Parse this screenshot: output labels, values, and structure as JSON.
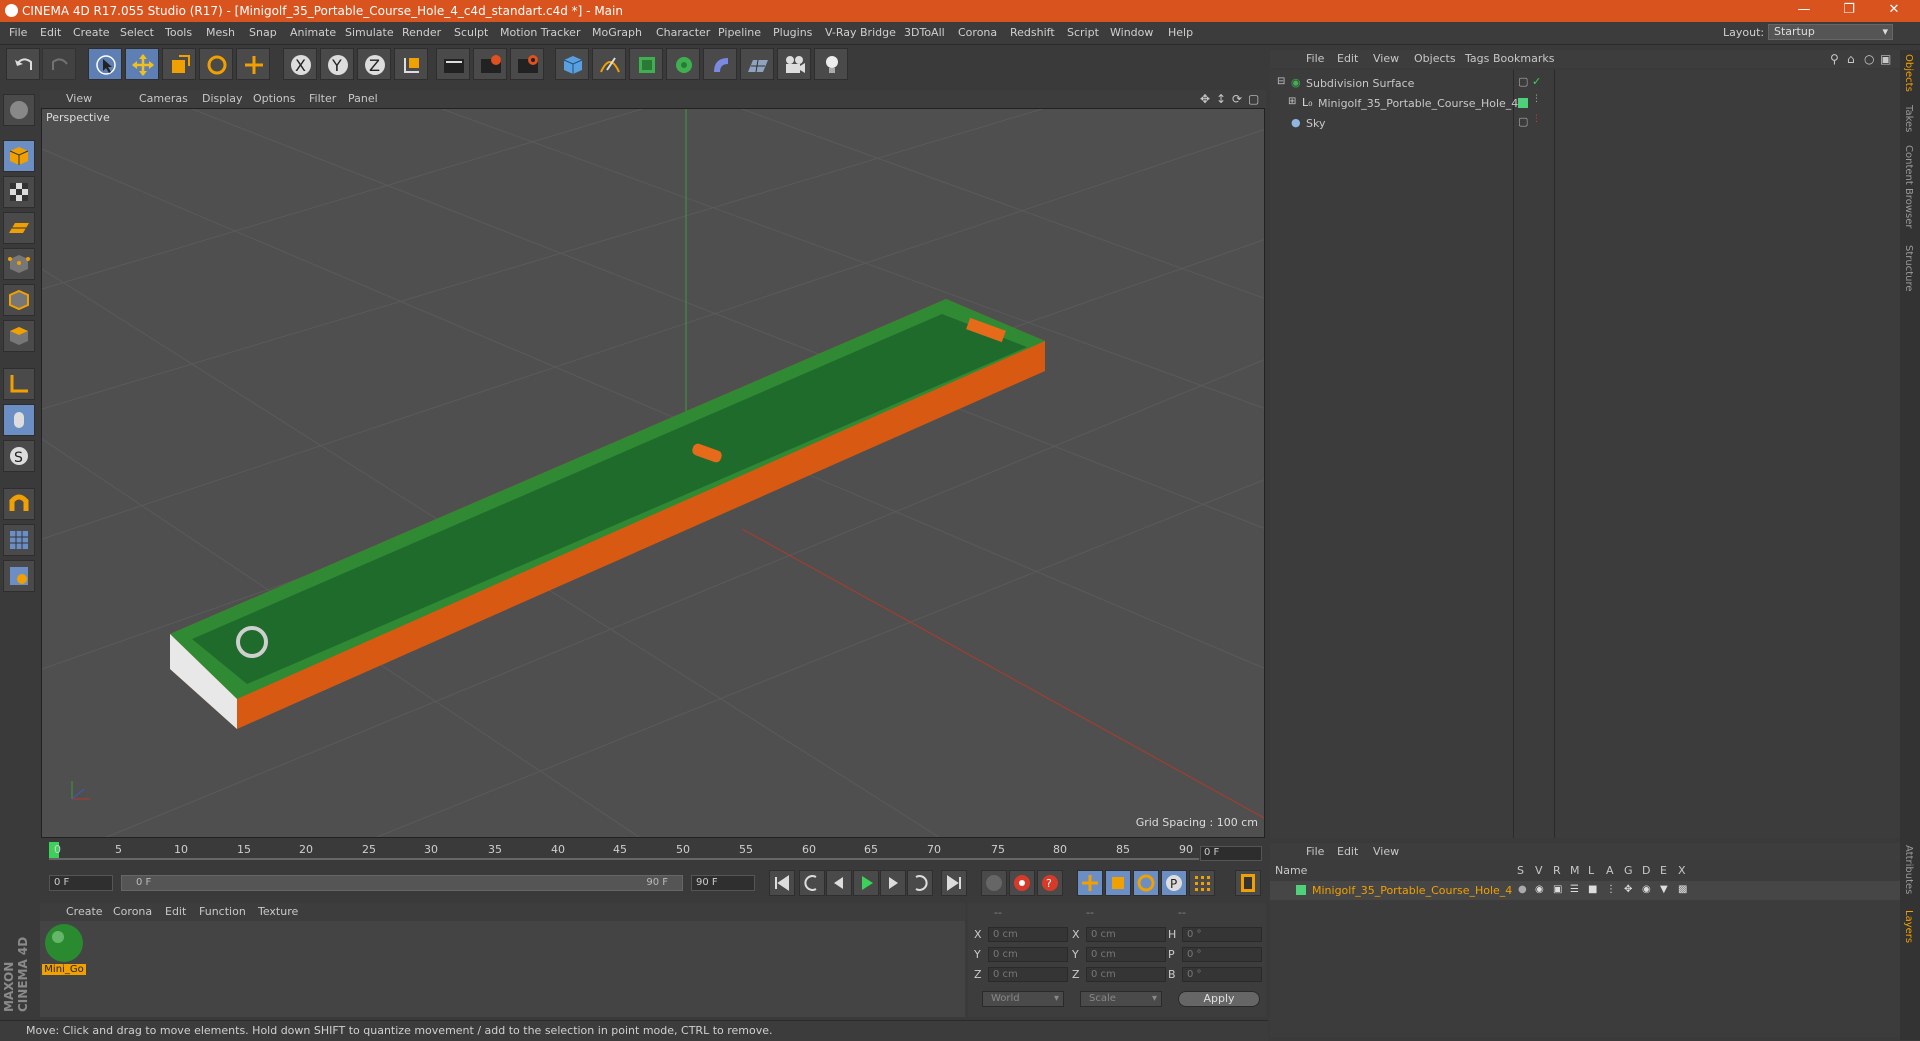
{
  "window": {
    "title": "CINEMA 4D R17.055 Studio (R17) - [Minigolf_35_Portable_Course_Hole_4_c4d_standart.c4d *] - Main",
    "min_icon": "minimize-icon",
    "max_icon": "restore-icon",
    "close_icon": "close-icon"
  },
  "menubar": {
    "items": [
      "File",
      "Edit",
      "Create",
      "Select",
      "Tools",
      "Mesh",
      "Snap",
      "Animate",
      "Simulate",
      "Render",
      "Sculpt",
      "Motion Tracker",
      "MoGraph",
      "Character",
      "Pipeline",
      "Plugins",
      "V-Ray Bridge",
      "3DToAll",
      "Corona",
      "Redshift",
      "Script",
      "Window",
      "Help"
    ],
    "layout_label": "Layout:",
    "layout_value": "Startup"
  },
  "viewport": {
    "menu": [
      "View",
      "Cameras",
      "Display",
      "Options",
      "Filter",
      "Panel"
    ],
    "label": "Perspective",
    "grid_spacing": "Grid Spacing : 100 cm"
  },
  "timeline": {
    "ticks": [
      "0",
      "5",
      "10",
      "15",
      "20",
      "25",
      "30",
      "35",
      "40",
      "45",
      "50",
      "55",
      "60",
      "65",
      "70",
      "75",
      "80",
      "85",
      "90"
    ],
    "current_frame": "0 F",
    "start_field": "0 F",
    "slider_start": "0 F",
    "slider_end": "90 F",
    "end_field": "90 F"
  },
  "material_manager": {
    "menu": [
      "Create",
      "Corona",
      "Edit",
      "Function",
      "Texture"
    ],
    "material_label": "Mini_Go"
  },
  "coordinates": {
    "headers": [
      "--",
      "--",
      "--"
    ],
    "rows": [
      {
        "a": "X",
        "av": "0 cm",
        "b": "X",
        "bv": "0 cm",
        "c": "H",
        "cv": "0 °"
      },
      {
        "a": "Y",
        "av": "0 cm",
        "b": "Y",
        "bv": "0 cm",
        "c": "P",
        "cv": "0 °"
      },
      {
        "a": "Z",
        "av": "0 cm",
        "b": "Z",
        "bv": "0 cm",
        "c": "B",
        "cv": "0 °"
      }
    ],
    "world_select": "World",
    "scale_select": "Scale",
    "apply_label": "Apply"
  },
  "object_manager": {
    "menu": [
      "File",
      "Edit",
      "View",
      "Objects",
      "Tags",
      "Bookmarks"
    ],
    "objects": [
      {
        "name": "Subdivision Surface"
      },
      {
        "name": "Minigolf_35_Portable_Course_Hole_4"
      },
      {
        "name": "Sky"
      }
    ]
  },
  "layer_manager": {
    "menu": [
      "File",
      "Edit",
      "View"
    ],
    "column_name": "Name",
    "columns": [
      "S",
      "V",
      "R",
      "M",
      "L",
      "A",
      "G",
      "D",
      "E",
      "X"
    ],
    "layer_name": "Minigolf_35_Portable_Course_Hole_4"
  },
  "right_tabs": [
    "Objects",
    "Takes",
    "Content Browser",
    "Structure",
    "Attributes",
    "Layers"
  ],
  "status": "Move: Click and drag to move elements. Hold down SHIFT to quantize movement / add to the selection in point mode, CTRL to remove.",
  "brand": "MAXON CINEMA 4D",
  "colors": {
    "title_bar": "#d9531e",
    "accent_orange": "#f0a000",
    "selection_blue": "#6b8fc4",
    "layer_green": "#4fd17a"
  }
}
